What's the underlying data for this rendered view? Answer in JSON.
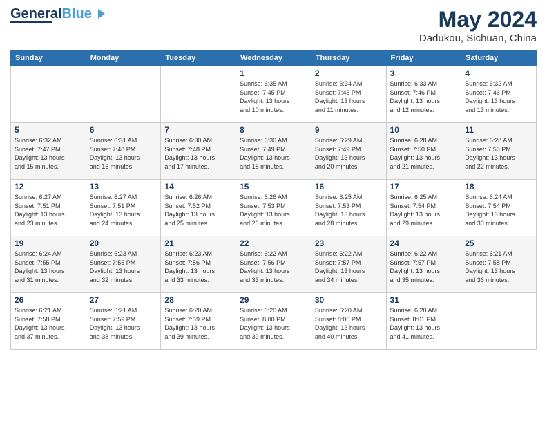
{
  "header": {
    "logo_general": "General",
    "logo_blue": "Blue",
    "month_title": "May 2024",
    "location": "Dadukou, Sichuan, China"
  },
  "weekdays": [
    "Sunday",
    "Monday",
    "Tuesday",
    "Wednesday",
    "Thursday",
    "Friday",
    "Saturday"
  ],
  "weeks": [
    [
      {
        "day": "",
        "info": ""
      },
      {
        "day": "",
        "info": ""
      },
      {
        "day": "",
        "info": ""
      },
      {
        "day": "1",
        "info": "Sunrise: 6:35 AM\nSunset: 7:45 PM\nDaylight: 13 hours\nand 10 minutes."
      },
      {
        "day": "2",
        "info": "Sunrise: 6:34 AM\nSunset: 7:45 PM\nDaylight: 13 hours\nand 11 minutes."
      },
      {
        "day": "3",
        "info": "Sunrise: 6:33 AM\nSunset: 7:46 PM\nDaylight: 13 hours\nand 12 minutes."
      },
      {
        "day": "4",
        "info": "Sunrise: 6:32 AM\nSunset: 7:46 PM\nDaylight: 13 hours\nand 13 minutes."
      }
    ],
    [
      {
        "day": "5",
        "info": "Sunrise: 6:32 AM\nSunset: 7:47 PM\nDaylight: 13 hours\nand 15 minutes."
      },
      {
        "day": "6",
        "info": "Sunrise: 6:31 AM\nSunset: 7:48 PM\nDaylight: 13 hours\nand 16 minutes."
      },
      {
        "day": "7",
        "info": "Sunrise: 6:30 AM\nSunset: 7:48 PM\nDaylight: 13 hours\nand 17 minutes."
      },
      {
        "day": "8",
        "info": "Sunrise: 6:30 AM\nSunset: 7:49 PM\nDaylight: 13 hours\nand 18 minutes."
      },
      {
        "day": "9",
        "info": "Sunrise: 6:29 AM\nSunset: 7:49 PM\nDaylight: 13 hours\nand 20 minutes."
      },
      {
        "day": "10",
        "info": "Sunrise: 6:28 AM\nSunset: 7:50 PM\nDaylight: 13 hours\nand 21 minutes."
      },
      {
        "day": "11",
        "info": "Sunrise: 6:28 AM\nSunset: 7:50 PM\nDaylight: 13 hours\nand 22 minutes."
      }
    ],
    [
      {
        "day": "12",
        "info": "Sunrise: 6:27 AM\nSunset: 7:51 PM\nDaylight: 13 hours\nand 23 minutes."
      },
      {
        "day": "13",
        "info": "Sunrise: 6:27 AM\nSunset: 7:51 PM\nDaylight: 13 hours\nand 24 minutes."
      },
      {
        "day": "14",
        "info": "Sunrise: 6:26 AM\nSunset: 7:52 PM\nDaylight: 13 hours\nand 25 minutes."
      },
      {
        "day": "15",
        "info": "Sunrise: 6:26 AM\nSunset: 7:53 PM\nDaylight: 13 hours\nand 26 minutes."
      },
      {
        "day": "16",
        "info": "Sunrise: 6:25 AM\nSunset: 7:53 PM\nDaylight: 13 hours\nand 28 minutes."
      },
      {
        "day": "17",
        "info": "Sunrise: 6:25 AM\nSunset: 7:54 PM\nDaylight: 13 hours\nand 29 minutes."
      },
      {
        "day": "18",
        "info": "Sunrise: 6:24 AM\nSunset: 7:54 PM\nDaylight: 13 hours\nand 30 minutes."
      }
    ],
    [
      {
        "day": "19",
        "info": "Sunrise: 6:24 AM\nSunset: 7:55 PM\nDaylight: 13 hours\nand 31 minutes."
      },
      {
        "day": "20",
        "info": "Sunrise: 6:23 AM\nSunset: 7:55 PM\nDaylight: 13 hours\nand 32 minutes."
      },
      {
        "day": "21",
        "info": "Sunrise: 6:23 AM\nSunset: 7:56 PM\nDaylight: 13 hours\nand 33 minutes."
      },
      {
        "day": "22",
        "info": "Sunrise: 6:22 AM\nSunset: 7:56 PM\nDaylight: 13 hours\nand 33 minutes."
      },
      {
        "day": "23",
        "info": "Sunrise: 6:22 AM\nSunset: 7:57 PM\nDaylight: 13 hours\nand 34 minutes."
      },
      {
        "day": "24",
        "info": "Sunrise: 6:22 AM\nSunset: 7:57 PM\nDaylight: 13 hours\nand 35 minutes."
      },
      {
        "day": "25",
        "info": "Sunrise: 6:21 AM\nSunset: 7:58 PM\nDaylight: 13 hours\nand 36 minutes."
      }
    ],
    [
      {
        "day": "26",
        "info": "Sunrise: 6:21 AM\nSunset: 7:58 PM\nDaylight: 13 hours\nand 37 minutes."
      },
      {
        "day": "27",
        "info": "Sunrise: 6:21 AM\nSunset: 7:59 PM\nDaylight: 13 hours\nand 38 minutes."
      },
      {
        "day": "28",
        "info": "Sunrise: 6:20 AM\nSunset: 7:59 PM\nDaylight: 13 hours\nand 39 minutes."
      },
      {
        "day": "29",
        "info": "Sunrise: 6:20 AM\nSunset: 8:00 PM\nDaylight: 13 hours\nand 39 minutes."
      },
      {
        "day": "30",
        "info": "Sunrise: 6:20 AM\nSunset: 8:00 PM\nDaylight: 13 hours\nand 40 minutes."
      },
      {
        "day": "31",
        "info": "Sunrise: 6:20 AM\nSunset: 8:01 PM\nDaylight: 13 hours\nand 41 minutes."
      },
      {
        "day": "",
        "info": ""
      }
    ]
  ]
}
